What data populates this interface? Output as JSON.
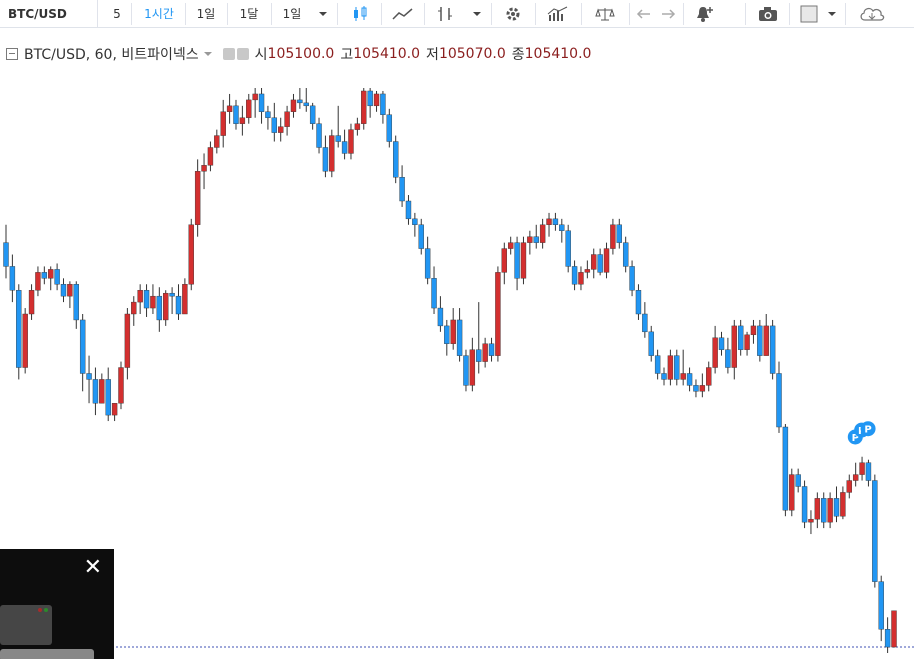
{
  "toolbar": {
    "symbol": "BTC/USD",
    "intervals": [
      "5",
      "1시간",
      "1일",
      "1달",
      "1일"
    ],
    "active_interval_index": 1,
    "icons": [
      "dropdown-icon",
      "candles-icon",
      "area-icon",
      "bars-icon",
      "dropdown-icon",
      "settings-icon",
      "indicators-icon",
      "compare-icon",
      "undo-icon",
      "redo-icon",
      "alert-icon",
      "camera-icon",
      "square-icon",
      "dropdown-icon",
      "cloud-icon"
    ]
  },
  "legend": {
    "title": "BTC/USD, 60, 비트파이넥스",
    "open_label": "시",
    "open_value": "105100.0",
    "high_label": "고",
    "high_value": "105410.0",
    "low_label": "저",
    "low_value": "105070.0",
    "close_label": "종",
    "close_value": "105410.0"
  },
  "colors": {
    "up": "#d32f2f",
    "down": "#2196f3",
    "wick": "#333333",
    "marker": "#2196f3",
    "price_line": "#3f51b5"
  },
  "markers": [
    "P",
    "P",
    "P"
  ],
  "video": {
    "close_symbol": "✕"
  },
  "chart_data": {
    "type": "candlestick",
    "symbol": "BTC/USD",
    "interval": "60",
    "exchange": "비트파이넥스",
    "ylim": [
      104700,
      114200
    ],
    "price_line": 104800,
    "candles": [
      [
        111600,
        111900,
        111000,
        111200
      ],
      [
        111200,
        111400,
        110600,
        110800
      ],
      [
        110800,
        110900,
        109300,
        109500
      ],
      [
        109500,
        110500,
        109400,
        110400
      ],
      [
        110400,
        110900,
        110300,
        110800
      ],
      [
        110800,
        111200,
        110700,
        111100
      ],
      [
        111100,
        111200,
        110900,
        111000
      ],
      [
        111000,
        111200,
        110800,
        111150
      ],
      [
        111150,
        111250,
        110800,
        110900
      ],
      [
        110900,
        111000,
        110600,
        110700
      ],
      [
        110700,
        110950,
        110500,
        110900
      ],
      [
        110900,
        110950,
        110150,
        110300
      ],
      [
        110300,
        110400,
        109100,
        109400
      ],
      [
        109400,
        109700,
        108900,
        109300
      ],
      [
        109300,
        109500,
        108700,
        108900
      ],
      [
        108900,
        109400,
        108900,
        109300
      ],
      [
        109300,
        109500,
        108600,
        108700
      ],
      [
        108700,
        108900,
        108600,
        108900
      ],
      [
        108900,
        109600,
        108800,
        109500
      ],
      [
        109500,
        110500,
        109300,
        110400
      ],
      [
        110400,
        110700,
        110200,
        110600
      ],
      [
        110600,
        110900,
        110400,
        110800
      ],
      [
        110800,
        110900,
        110350,
        110500
      ],
      [
        110500,
        110900,
        110400,
        110700
      ],
      [
        110700,
        110850,
        110100,
        110300
      ],
      [
        110300,
        110800,
        110200,
        110750
      ],
      [
        110750,
        110850,
        110400,
        110700
      ],
      [
        110700,
        110900,
        110300,
        110400
      ],
      [
        110400,
        111000,
        110400,
        110900
      ],
      [
        110900,
        112000,
        110800,
        111900
      ],
      [
        111900,
        113000,
        111700,
        112800
      ],
      [
        112800,
        113100,
        112500,
        112900
      ],
      [
        112900,
        113300,
        112800,
        113200
      ],
      [
        113200,
        113500,
        113100,
        113400
      ],
      [
        113400,
        114000,
        113200,
        113800
      ],
      [
        113800,
        114100,
        113600,
        113900
      ],
      [
        113900,
        114000,
        113500,
        113600
      ],
      [
        113600,
        113900,
        113400,
        113700
      ],
      [
        113700,
        114100,
        113600,
        114000
      ],
      [
        114000,
        114200,
        113700,
        114100
      ],
      [
        114100,
        114200,
        113600,
        113800
      ],
      [
        113800,
        113900,
        113500,
        113700
      ],
      [
        113700,
        113950,
        113300,
        113450
      ],
      [
        113450,
        113700,
        113300,
        113550
      ],
      [
        113550,
        113900,
        113400,
        113800
      ],
      [
        113800,
        114100,
        113700,
        114000
      ],
      [
        114000,
        114200,
        113850,
        113950
      ],
      [
        113950,
        114200,
        113800,
        113900
      ],
      [
        113900,
        113950,
        113500,
        113600
      ],
      [
        113600,
        113700,
        113100,
        113200
      ],
      [
        113200,
        113400,
        112700,
        112800
      ],
      [
        112800,
        113500,
        112700,
        113400
      ],
      [
        113400,
        113900,
        113200,
        113300
      ],
      [
        113300,
        113500,
        113000,
        113100
      ],
      [
        113100,
        113600,
        113000,
        113500
      ],
      [
        113500,
        113700,
        113400,
        113600
      ],
      [
        113600,
        114200,
        113500,
        114150
      ],
      [
        114150,
        114200,
        113700,
        113900
      ],
      [
        113900,
        114150,
        113800,
        114100
      ],
      [
        114100,
        114150,
        113600,
        113750
      ],
      [
        113750,
        113850,
        113200,
        113300
      ],
      [
        113300,
        113400,
        112600,
        112700
      ],
      [
        112700,
        112900,
        112200,
        112300
      ],
      [
        112300,
        112400,
        111900,
        112000
      ],
      [
        112000,
        112100,
        111700,
        111900
      ],
      [
        111900,
        112000,
        111400,
        111500
      ],
      [
        111500,
        111700,
        110900,
        111000
      ],
      [
        111000,
        111200,
        110400,
        110500
      ],
      [
        110500,
        110700,
        110100,
        110200
      ],
      [
        110200,
        110300,
        109700,
        109900
      ],
      [
        109900,
        110500,
        109800,
        110300
      ],
      [
        110300,
        110500,
        109600,
        109700
      ],
      [
        109700,
        109800,
        109100,
        109200
      ],
      [
        109200,
        110000,
        109100,
        109800
      ],
      [
        109800,
        110600,
        109400,
        109600
      ],
      [
        109600,
        110000,
        109500,
        109900
      ],
      [
        109900,
        110000,
        109600,
        109700
      ],
      [
        109700,
        111200,
        109600,
        111100
      ],
      [
        111100,
        111600,
        110900,
        111500
      ],
      [
        111500,
        111700,
        111400,
        111600
      ],
      [
        111600,
        111700,
        110800,
        111000
      ],
      [
        111000,
        111700,
        110900,
        111600
      ],
      [
        111600,
        111800,
        111400,
        111700
      ],
      [
        111700,
        111900,
        111500,
        111600
      ],
      [
        111600,
        112000,
        111500,
        111900
      ],
      [
        111900,
        112100,
        111700,
        112000
      ],
      [
        112000,
        112100,
        111800,
        111900
      ],
      [
        111900,
        112000,
        111600,
        111800
      ],
      [
        111800,
        111900,
        111100,
        111200
      ],
      [
        111200,
        111300,
        110800,
        110900
      ],
      [
        110900,
        111200,
        110800,
        111100
      ],
      [
        111100,
        111300,
        111000,
        111150
      ],
      [
        111150,
        111500,
        111000,
        111400
      ],
      [
        111400,
        111500,
        111050,
        111100
      ],
      [
        111100,
        111600,
        111000,
        111500
      ],
      [
        111500,
        112000,
        111400,
        111900
      ],
      [
        111900,
        112000,
        111500,
        111600
      ],
      [
        111600,
        111700,
        111100,
        111200
      ],
      [
        111200,
        111300,
        110700,
        110800
      ],
      [
        110800,
        110900,
        110300,
        110400
      ],
      [
        110400,
        110600,
        110000,
        110100
      ],
      [
        110100,
        110200,
        109600,
        109700
      ],
      [
        109700,
        109800,
        109300,
        109400
      ],
      [
        109400,
        109500,
        109200,
        109300
      ],
      [
        109300,
        109800,
        109200,
        109700
      ],
      [
        109700,
        109800,
        109200,
        109300
      ],
      [
        109300,
        109800,
        109200,
        109400
      ],
      [
        109400,
        109500,
        109100,
        109200
      ],
      [
        109200,
        109300,
        109000,
        109100
      ],
      [
        109100,
        109400,
        109000,
        109200
      ],
      [
        109200,
        109600,
        109100,
        109500
      ],
      [
        109500,
        110200,
        109400,
        110000
      ],
      [
        110000,
        110100,
        109700,
        109800
      ],
      [
        109800,
        110000,
        109400,
        109500
      ],
      [
        109500,
        110300,
        109300,
        110200
      ],
      [
        110200,
        110300,
        109700,
        109800
      ],
      [
        109800,
        110100,
        109700,
        110050
      ],
      [
        110050,
        110300,
        109900,
        110200
      ],
      [
        110200,
        110300,
        109600,
        109700
      ],
      [
        109700,
        110400,
        109700,
        110200
      ],
      [
        110200,
        110300,
        109300,
        109400
      ],
      [
        109400,
        109600,
        108400,
        108500
      ],
      [
        108500,
        108550,
        107000,
        107100
      ],
      [
        107100,
        107800,
        107000,
        107700
      ],
      [
        107700,
        107800,
        107400,
        107500
      ],
      [
        107500,
        107600,
        106800,
        106900
      ],
      [
        106900,
        107100,
        106700,
        106950
      ],
      [
        106950,
        107400,
        106800,
        107300
      ],
      [
        107300,
        107400,
        106800,
        106900
      ],
      [
        106900,
        107400,
        106800,
        107300
      ],
      [
        107300,
        107500,
        106900,
        107000
      ],
      [
        107000,
        107500,
        106950,
        107400
      ],
      [
        107400,
        107700,
        107300,
        107600
      ],
      [
        107600,
        107900,
        107500,
        107700
      ],
      [
        107700,
        108000,
        107600,
        107900
      ],
      [
        107900,
        107950,
        107500,
        107600
      ],
      [
        107600,
        107700,
        105800,
        105900
      ],
      [
        105900,
        106000,
        104900,
        105100
      ],
      [
        105100,
        105300,
        104700,
        104800
      ],
      [
        104800,
        105410,
        104790,
        105410
      ]
    ]
  }
}
